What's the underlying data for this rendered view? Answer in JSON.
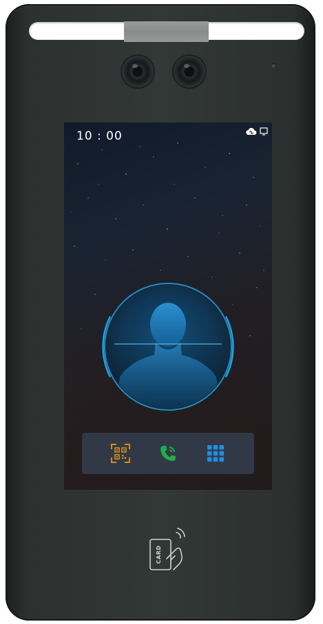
{
  "status_bar": {
    "time": "10 : 00",
    "cloud_icon": "cloud-connected-icon",
    "monitor_icon": "screen-icon"
  },
  "toolbar": {
    "buttons": [
      {
        "name": "qr-code-scan",
        "icon": "qr-scan-icon",
        "color": "#d98a1c"
      },
      {
        "name": "call",
        "icon": "phone-call-icon",
        "color": "#1fae4b"
      },
      {
        "name": "keypad",
        "icon": "keypad-grid-icon",
        "color": "#1f8fe0"
      }
    ]
  },
  "card_reader": {
    "label": "CARD",
    "icon": "card-tap-icon"
  },
  "colors": {
    "device_body": "#323836",
    "scan_ring": "#1aa3e8",
    "face_fill": "#1f7fbf"
  }
}
